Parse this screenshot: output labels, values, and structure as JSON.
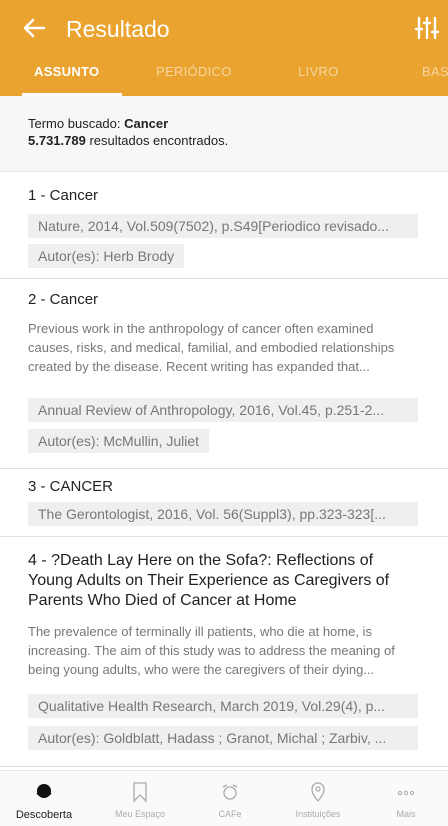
{
  "header": {
    "title": "Resultado"
  },
  "tabs": [
    {
      "label": "ASSUNTO"
    },
    {
      "label": "PERIÓDICO"
    },
    {
      "label": "LIVRO"
    },
    {
      "label": "BAS"
    }
  ],
  "summary": {
    "term_label": "Termo buscado:",
    "term_value": "Cancer",
    "count": "5.731.789",
    "count_suffix": "resultados encontrados."
  },
  "results": [
    {
      "title": "1 - Cancer",
      "source": "Nature, 2014, Vol.509(7502), p.S49[Periodico revisado...",
      "authors": "Autor(es): Herb Brody"
    },
    {
      "title": "2 - Cancer",
      "abstract": "Previous work in the anthropology of cancer often examined causes, risks, and medical, familial, and embodied relationships created by the disease. Recent writing has expanded that...",
      "source": "Annual Review of Anthropology, 2016, Vol.45, p.251-2...",
      "authors": "Autor(es): McMullin, Juliet"
    },
    {
      "title": "3 - CANCER",
      "source": "The Gerontologist, 2016, Vol. 56(Suppl3), pp.323-323[..."
    },
    {
      "title": "4 - ?Death Lay Here on the Sofa?: Reflections of Young Adults on Their Experience as Caregivers of Parents Who Died of Cancer at Home",
      "abstract": "The prevalence of terminally ill patients, who die at home, is increasing. The aim of this study was to address the meaning of being young adults, who were the caregivers of their dying...",
      "source": "Qualitative Health Research, March 2019, Vol.29(4), p...",
      "authors": "Autor(es): Goldblatt, Hadass ; Granot, Michal ; Zarbiv, ..."
    }
  ],
  "bottom_nav": [
    {
      "label": "Descoberta",
      "icon": "discovery-icon"
    },
    {
      "label": "Meu Espaço",
      "icon": "bookmark-icon"
    },
    {
      "label": "CAFe",
      "icon": "cafe-icon"
    },
    {
      "label": "Instituições",
      "icon": "location-pin-icon"
    },
    {
      "label": "Mais",
      "icon": "more-dots-icon"
    }
  ],
  "colors": {
    "brand": "#eaa32e",
    "chip_bg": "#efefef",
    "muted_text": "#777777"
  }
}
